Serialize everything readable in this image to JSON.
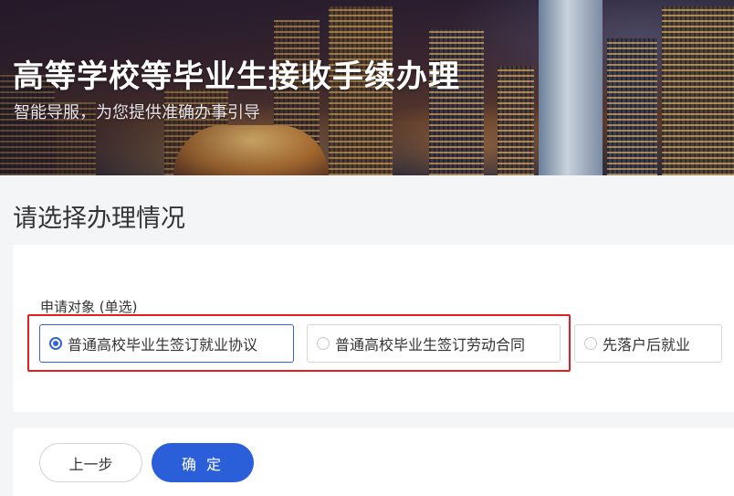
{
  "hero": {
    "title": "高等学校等毕业生接收手续办理",
    "subtitle": "智能导服，为您提供准确办事引导"
  },
  "section": {
    "title": "请选择办理情况"
  },
  "form": {
    "field_label": "申请对象 (单选)",
    "options": [
      {
        "label": "普通高校毕业生签订就业协议",
        "selected": true
      },
      {
        "label": "普通高校毕业生签订劳动合同",
        "selected": false
      },
      {
        "label": "先落户后就业",
        "selected": false
      }
    ]
  },
  "actions": {
    "prev_label": "上一步",
    "confirm_label": "确 定"
  },
  "colors": {
    "accent": "#2b5fd9",
    "highlight": "#e02020"
  }
}
